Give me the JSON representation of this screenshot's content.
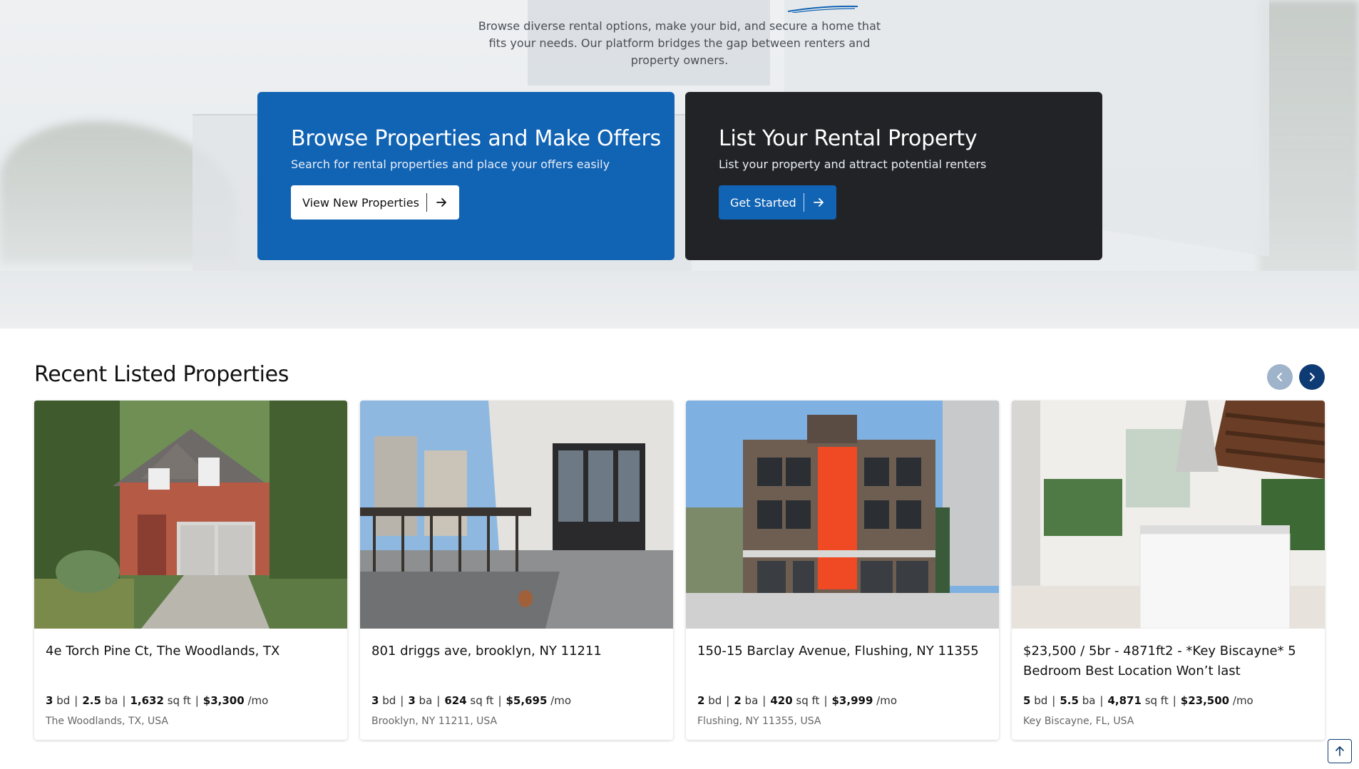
{
  "hero": {
    "description": "Browse diverse rental options, make your bid, and secure a home that fits your needs. Our platform bridges the gap between renters and property owners.",
    "cards": [
      {
        "title": "Browse Properties and Make Offers",
        "subtitle": "Search for rental properties and place your offers easily",
        "button": "View New Properties",
        "color": "#1163b4"
      },
      {
        "title": "List Your Rental Property",
        "subtitle": "List your property and attract potential renters",
        "button": "Get Started",
        "color": "#222327"
      }
    ]
  },
  "recent": {
    "title": "Recent Listed Properties",
    "prev_icon": "chevron-left-icon",
    "next_icon": "chevron-right-icon",
    "properties": [
      {
        "title": "4e Torch Pine Ct, The Woodlands, TX",
        "bd": "3",
        "bd_label": "bd",
        "ba": "2.5",
        "ba_label": "ba",
        "sqft": "1,632",
        "sqft_label": "sq ft",
        "price": "$3,300",
        "price_label": "/mo",
        "location": "The Woodlands, TX, USA"
      },
      {
        "title": "801 driggs ave, brooklyn, NY 11211",
        "bd": "3",
        "bd_label": "bd",
        "ba": "3",
        "ba_label": "ba",
        "sqft": "624",
        "sqft_label": "sq ft",
        "price": "$5,695",
        "price_label": "/mo",
        "location": "Brooklyn, NY 11211, USA"
      },
      {
        "title": "150-15 Barclay Avenue, Flushing, NY 11355",
        "bd": "2",
        "bd_label": "bd",
        "ba": "2",
        "ba_label": "ba",
        "sqft": "420",
        "sqft_label": "sq ft",
        "price": "$3,999",
        "price_label": "/mo",
        "location": "Flushing, NY 11355, USA"
      },
      {
        "title": "$23,500 / 5br - 4871ft2 - *Key Biscayne* 5 Bedroom Best Location Won’t last",
        "bd": "5",
        "bd_label": "bd",
        "ba": "5.5",
        "ba_label": "ba",
        "sqft": "4,871",
        "sqft_label": "sq ft",
        "price": "$23,500",
        "price_label": "/mo",
        "location": "Key Biscayne, FL, USA"
      }
    ]
  },
  "scroll_top_icon": "arrow-up-icon"
}
